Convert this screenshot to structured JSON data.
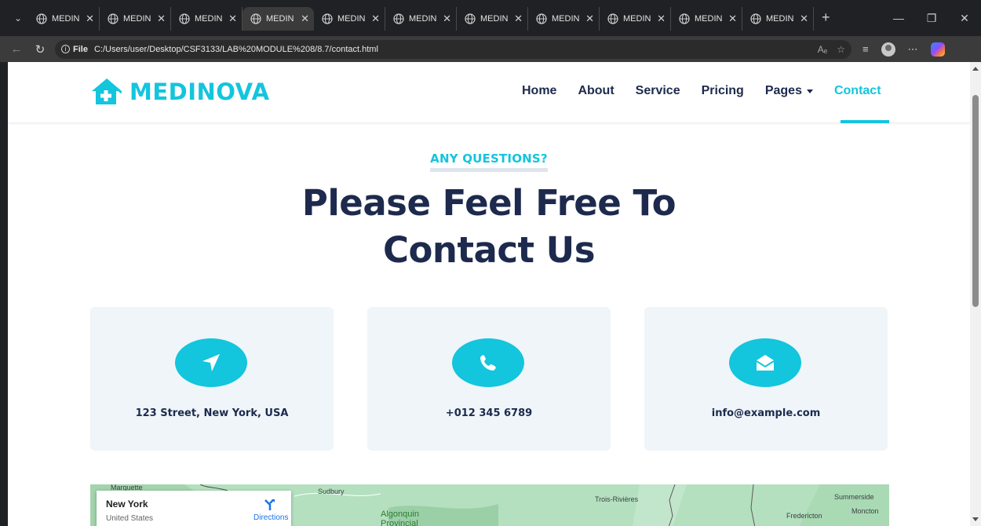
{
  "browser": {
    "tabs": [
      {
        "title": "MEDIN"
      },
      {
        "title": "MEDIN"
      },
      {
        "title": "MEDIN"
      },
      {
        "title": "MEDIN",
        "active": true
      },
      {
        "title": "MEDIN"
      },
      {
        "title": "MEDIN"
      },
      {
        "title": "MEDIN"
      },
      {
        "title": "MEDIN"
      },
      {
        "title": "MEDIN"
      },
      {
        "title": "MEDIN"
      },
      {
        "title": "MEDIN"
      }
    ],
    "address": {
      "scheme_label": "File",
      "url": "C:/Users/user/Desktop/CSF3133/LAB%20MODULE%208/8.7/contact.html"
    }
  },
  "site": {
    "brand": "MEDINOVA",
    "nav": [
      {
        "label": "Home"
      },
      {
        "label": "About"
      },
      {
        "label": "Service"
      },
      {
        "label": "Pricing"
      },
      {
        "label": "Pages"
      },
      {
        "label": "Contact"
      }
    ],
    "eyebrow": "ANY QUESTIONS?",
    "heading_line1": "Please Feel Free To",
    "heading_line2": "Contact Us",
    "cards": [
      {
        "icon": "location-arrow-icon",
        "text": "123 Street, New York, USA"
      },
      {
        "icon": "phone-icon",
        "text": "+012 345 6789"
      },
      {
        "icon": "envelope-open-icon",
        "text": "info@example.com"
      }
    ]
  },
  "map": {
    "place": "New York",
    "country": "United States",
    "directions_label": "Directions",
    "labels": [
      "Marquette",
      "Sudbury",
      "Algonquin",
      "Provincial",
      "Trois-Rivières",
      "Summerside",
      "Moncton",
      "Fredericton"
    ]
  },
  "colors": {
    "accent": "#13c5dd",
    "navy": "#1d2a4d",
    "card_bg": "#eff5f9"
  }
}
